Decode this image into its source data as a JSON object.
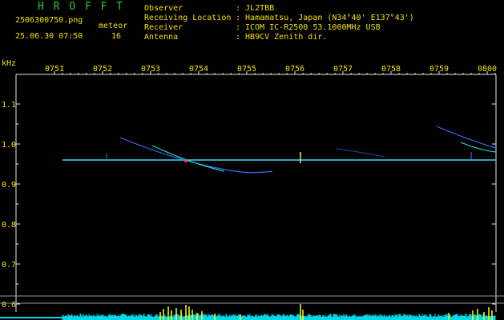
{
  "header": {
    "app_title": "H R O F F T",
    "filename": "2506300750.png",
    "datetime": "25.06.30 07:50",
    "meteor_label": "meteor",
    "meteor_count": "16",
    "info": [
      {
        "label": "Observer",
        "value": ": JL2TBB"
      },
      {
        "label": "Receiving Location",
        "value": ": Hamamatsu, Japan (N34°40' E137°43')"
      },
      {
        "label": "Receiver",
        "value": ": ICOM IC-R2500 53.1000MHz USB"
      },
      {
        "label": "Antenna",
        "value": ": HB9CV Zenith dir."
      }
    ]
  },
  "chart_data": {
    "type": "spectrogram",
    "ylabel": "kHz",
    "x_ticks": [
      "0751",
      "0752",
      "0753",
      "0754",
      "0755",
      "0756",
      "0757",
      "0758",
      "0759",
      "0800"
    ],
    "y_ticks": [
      "1.1",
      "1.0",
      "0.9",
      "0.8",
      "0.7",
      "0.6"
    ],
    "ylim": [
      0.6,
      1.1
    ],
    "carrier_khz": 0.96,
    "meteor_count": 16
  },
  "colors": {
    "background": "#000000",
    "text_green": "#2ecc3c",
    "text_yellow": "#f5e000",
    "axis": "#e8e8e8",
    "carrier": "#3fd8ff",
    "bars_cyan": "#00d8e8",
    "bars_yellow": "#ffff00"
  }
}
